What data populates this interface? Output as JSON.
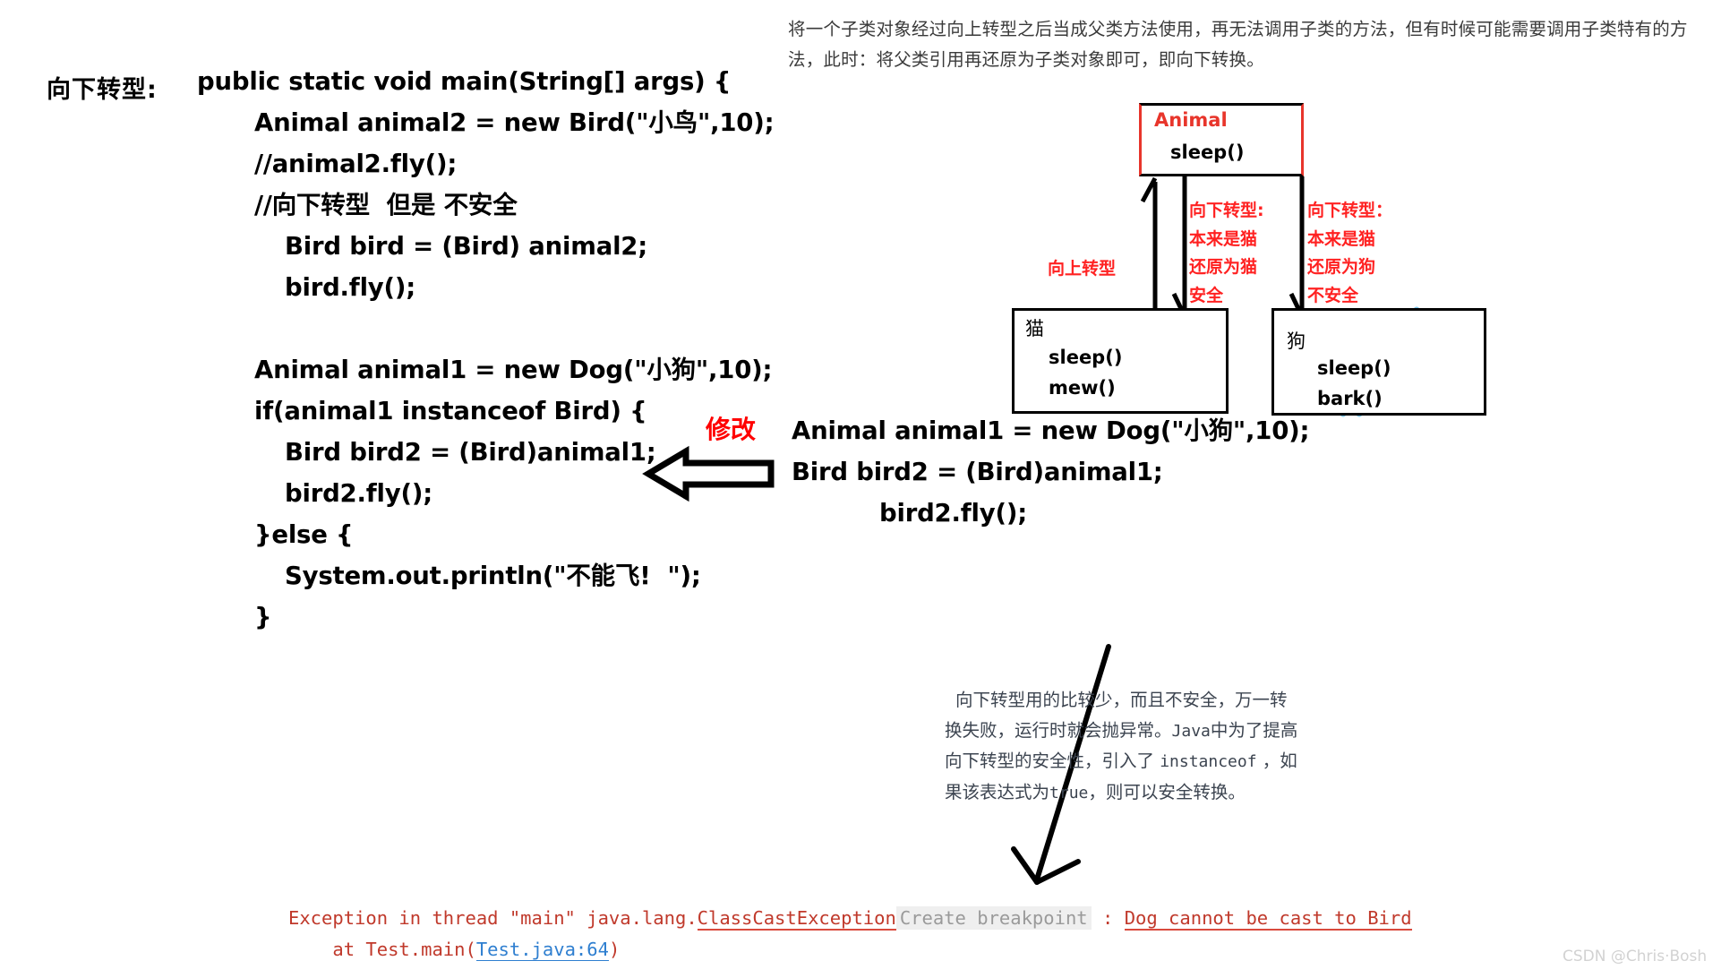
{
  "top_note": "将一个子类对象经过向上转型之后当成父类方法使用，再无法调用子类的方法，但有时候可能需要调用子类特有的方法，此时：将父类引用再还原为子类对象即可，即向下转换。",
  "section_title": "向下转型:",
  "code_left": {
    "lines": [
      {
        "text": "public static void main(String[] args) {",
        "indent": 0
      },
      {
        "text": "Animal animal2 = new Bird(\"小鸟\",10);",
        "indent": 1
      },
      {
        "text": "//animal2.fly();",
        "indent": 1
      },
      {
        "text": "//向下转型  但是 不安全",
        "indent": 1
      },
      {
        "text": "Bird bird = (Bird) animal2;",
        "indent": 2
      },
      {
        "text": "bird.fly();",
        "indent": 2
      },
      {
        "text": "",
        "indent": 0
      },
      {
        "text": "Animal animal1 = new Dog(\"小狗\",10);",
        "indent": 1
      },
      {
        "text": "if(animal1 instanceof Bird) {",
        "indent": 1
      },
      {
        "text": "Bird bird2 = (Bird)animal1;",
        "indent": 2
      },
      {
        "text": "bird2.fly();",
        "indent": 2
      },
      {
        "text": "}else {",
        "indent": 1
      },
      {
        "text": "System.out.println(\"不能飞!  \");",
        "indent": 2
      },
      {
        "text": "}",
        "indent": 1
      }
    ]
  },
  "modify_label": "修改",
  "code_right": {
    "lines": [
      {
        "text": "Animal animal1 = new Dog(\"小狗\",10);",
        "indent": 0
      },
      {
        "text": "Bird bird2 = (Bird)animal1;",
        "indent": 0
      },
      {
        "text": "bird2.fly();",
        "indent": 1
      }
    ]
  },
  "diagram": {
    "animal": {
      "title": "Animal",
      "methods": [
        "sleep()"
      ]
    },
    "cat": {
      "title": "猫",
      "methods": [
        "sleep()",
        "mew()"
      ]
    },
    "dog": {
      "title": "狗",
      "methods": [
        "sleep()",
        "bark()"
      ]
    },
    "label_upcast": "向上转型",
    "note_cat": "向下转型:\n本来是猫\n还原为猫\n安全",
    "note_dog": "向下转型：\n本来是猫\n还原为狗\n不安全",
    "colors": {
      "red": "#e8352b",
      "note_red": "#ff2222",
      "black": "#000000"
    }
  },
  "bottom_note": {
    "part1": "向下转型用的比较少，而且不安全，万一转换失败，运行时就会抛异常。",
    "mono1": "Java",
    "part2": "中为了提高向下转型的安全性，引入了 ",
    "mono2": "instanceof",
    "part3": " ，如果该表达式为",
    "mono3": "true",
    "part4": "，则可以安全转换。"
  },
  "console": {
    "line1_prefix": "Exception in thread \"main\" java.lang.",
    "line1_link": "ClassCastException",
    "line1_breakpoint": "Create breakpoint",
    "line1_colon": " : ",
    "line1_message": "Dog cannot be cast to Bird",
    "line2_prefix": "    at Test.main(",
    "line2_link": "Test.java:64",
    "line2_suffix": ")"
  },
  "watermark": "CSDN @Chris·Bosh"
}
